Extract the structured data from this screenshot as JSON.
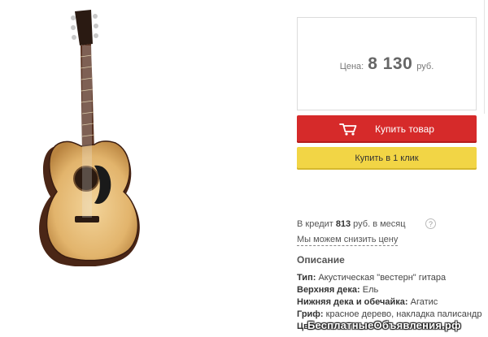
{
  "product": {
    "image_icon": "acoustic-guitar-illustration"
  },
  "price": {
    "label": "Цена:",
    "value": "8 130",
    "currency": "руб."
  },
  "buttons": {
    "buy_label": "Купить товар",
    "buy_icon": "cart-icon",
    "one_click_label": "Купить в 1 клик"
  },
  "credit": {
    "prefix": "В кредит",
    "amount": "813",
    "suffix": "руб. в месяц",
    "help_glyph": "?",
    "discount_link": "Мы можем снизить цену"
  },
  "description": {
    "title": "Описание",
    "specs": [
      {
        "key": "Тип:",
        "value": "Акустическая \"вестерн\" гитара"
      },
      {
        "key": "Верхняя дека:",
        "value": "Ель"
      },
      {
        "key": "Нижняя дека и обечайка:",
        "value": "Агатис"
      },
      {
        "key": "Гриф:",
        "value": "красное дерево, накладка палисандр"
      },
      {
        "key": "Цве",
        "value": ""
      }
    ]
  },
  "watermark": "БесплатныеОбъявления.рф",
  "colors": {
    "buy_button": "#d62a2a",
    "one_click_button": "#f2d545",
    "price_text": "#666666"
  }
}
